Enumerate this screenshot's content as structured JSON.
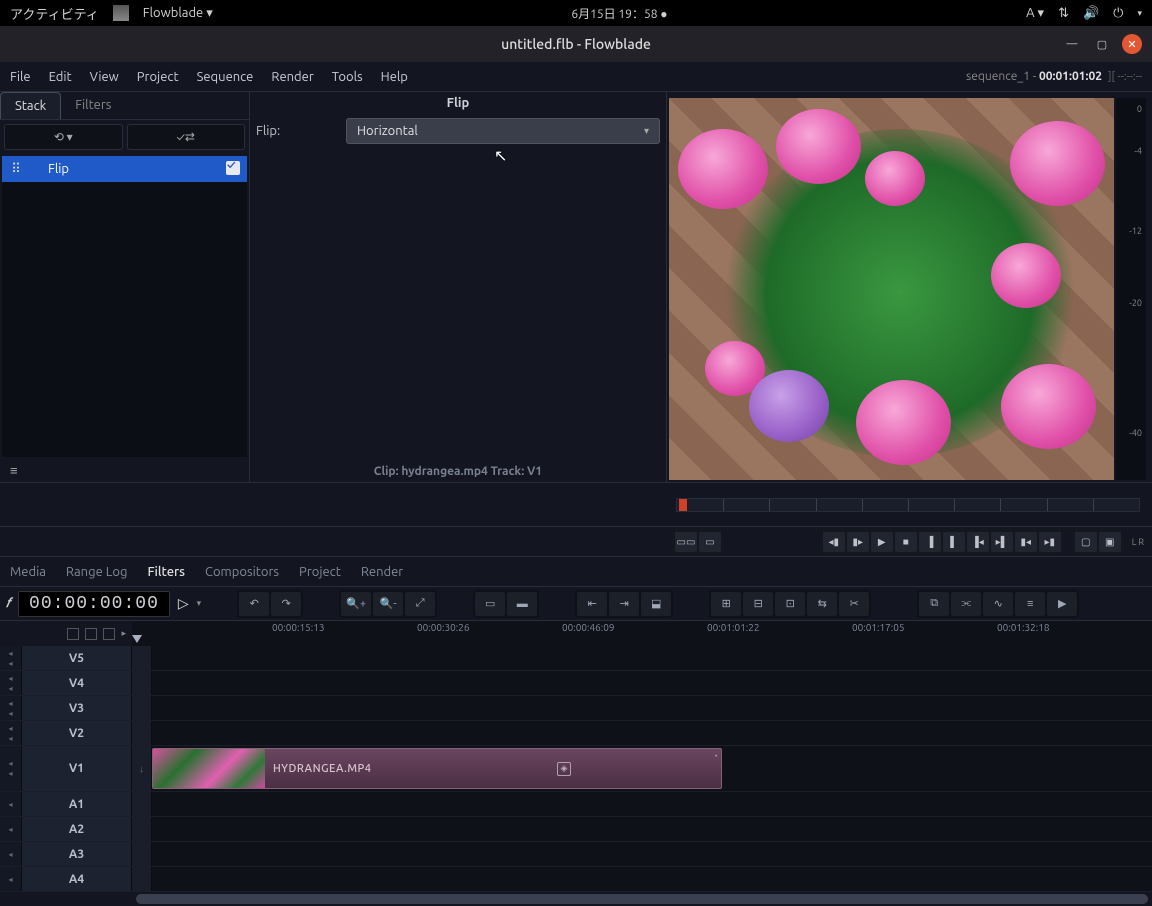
{
  "topbar": {
    "activities": "アクティビティ",
    "app_name": "Flowblade ▾",
    "datetime": "6月15日  19：58 ●",
    "input_indicator": "A ▾"
  },
  "window": {
    "title": "untitled.flb - Flowblade"
  },
  "menubar": {
    "items": [
      "File",
      "Edit",
      "View",
      "Project",
      "Sequence",
      "Render",
      "Tools",
      "Help"
    ],
    "sequence_label": "sequence_1 - ",
    "sequence_tc": "00:01:01:02",
    "tail": "][ --:--:--"
  },
  "stack_panel": {
    "tabs": [
      "Stack",
      "Filters"
    ],
    "active_tab": "Stack",
    "reset_btn": "⟲ ▾",
    "apply_btn": "✓⇄",
    "items": [
      {
        "name": "Flip",
        "enabled": true
      }
    ]
  },
  "filter_props": {
    "title": "Flip",
    "rows": [
      {
        "label": "Flip:",
        "value": "Horizontal"
      }
    ],
    "clip_info": "Clip: hydrangea.mp4     Track: V1"
  },
  "preview": {
    "meter_labels": [
      "0",
      "-4",
      "-12",
      "-20",
      "-40"
    ],
    "lr": "L R"
  },
  "bottom_tabs": {
    "items": [
      "Media",
      "Range Log",
      "Filters",
      "Compositors",
      "Project",
      "Render"
    ],
    "active": "Filters"
  },
  "timeline": {
    "timecode": "00:00:00:00",
    "ruler": [
      "00:00:15:13",
      "00:00:30:26",
      "00:00:46:09",
      "00:01:01:22",
      "00:01:17:05",
      "00:01:32:18"
    ],
    "video_tracks": [
      "V5",
      "V4",
      "V3",
      "V2",
      "V1"
    ],
    "audio_tracks": [
      "A1",
      "A2",
      "A3",
      "A4"
    ],
    "clip": {
      "label": "HYDRANGEA.MP4"
    }
  }
}
